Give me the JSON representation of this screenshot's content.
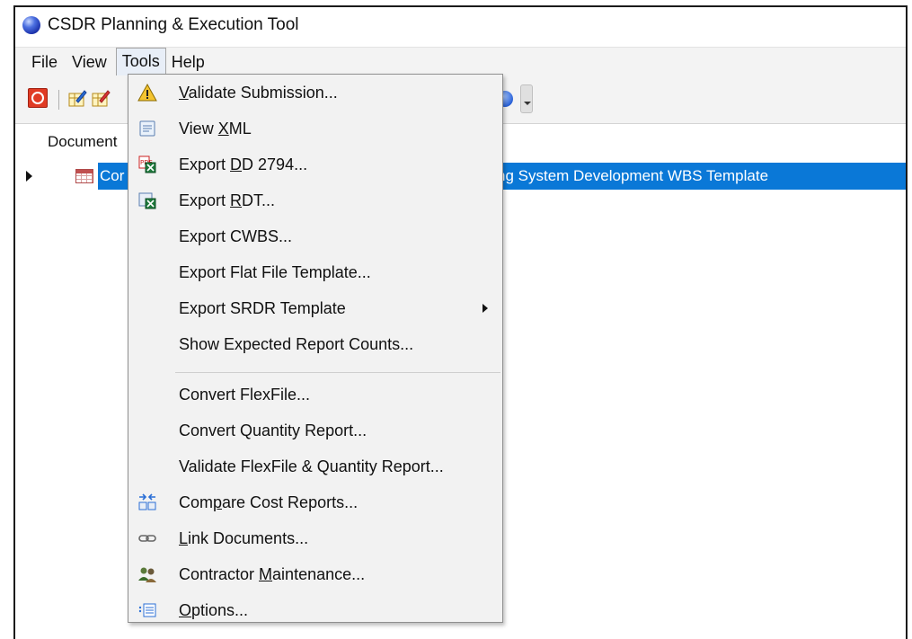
{
  "window": {
    "title": "CSDR Planning & Execution Tool"
  },
  "menubar": {
    "items": [
      {
        "label": "File"
      },
      {
        "label": "View"
      },
      {
        "label": "Tools"
      },
      {
        "label": "Help"
      }
    ]
  },
  "content": {
    "column_header": "Document",
    "selected_row_left": "Cor",
    "selected_row_right": "ng System Development WBS Template"
  },
  "tools_menu": {
    "items": [
      {
        "label": "Validate Submission...",
        "icon": "warning-icon"
      },
      {
        "label": "View XML",
        "icon": "xml-document-icon"
      },
      {
        "label": "Export DD 2794...",
        "icon": "pdf-excel-export-icon"
      },
      {
        "label": "Export RDT...",
        "icon": "excel-export-icon"
      },
      {
        "label": "Export CWBS..."
      },
      {
        "label": "Export Flat File Template..."
      },
      {
        "label": "Export SRDR Template",
        "has_submenu": true
      },
      {
        "label": "Show Expected Report Counts..."
      },
      {
        "label": "Convert FlexFile..."
      },
      {
        "label": "Convert Quantity Report..."
      },
      {
        "label": "Validate FlexFile & Quantity Report..."
      },
      {
        "label": "Compare Cost Reports...",
        "icon": "compare-icon"
      },
      {
        "label": "Link Documents...",
        "icon": "link-icon"
      },
      {
        "label": "Contractor Maintenance...",
        "icon": "contractors-icon"
      },
      {
        "label": "Options...",
        "icon": "options-list-icon"
      }
    ]
  },
  "colors": {
    "selection": "#0a78d7",
    "menu_bg": "#f2f2f2",
    "toolbar_bg": "#f3f3f3"
  }
}
